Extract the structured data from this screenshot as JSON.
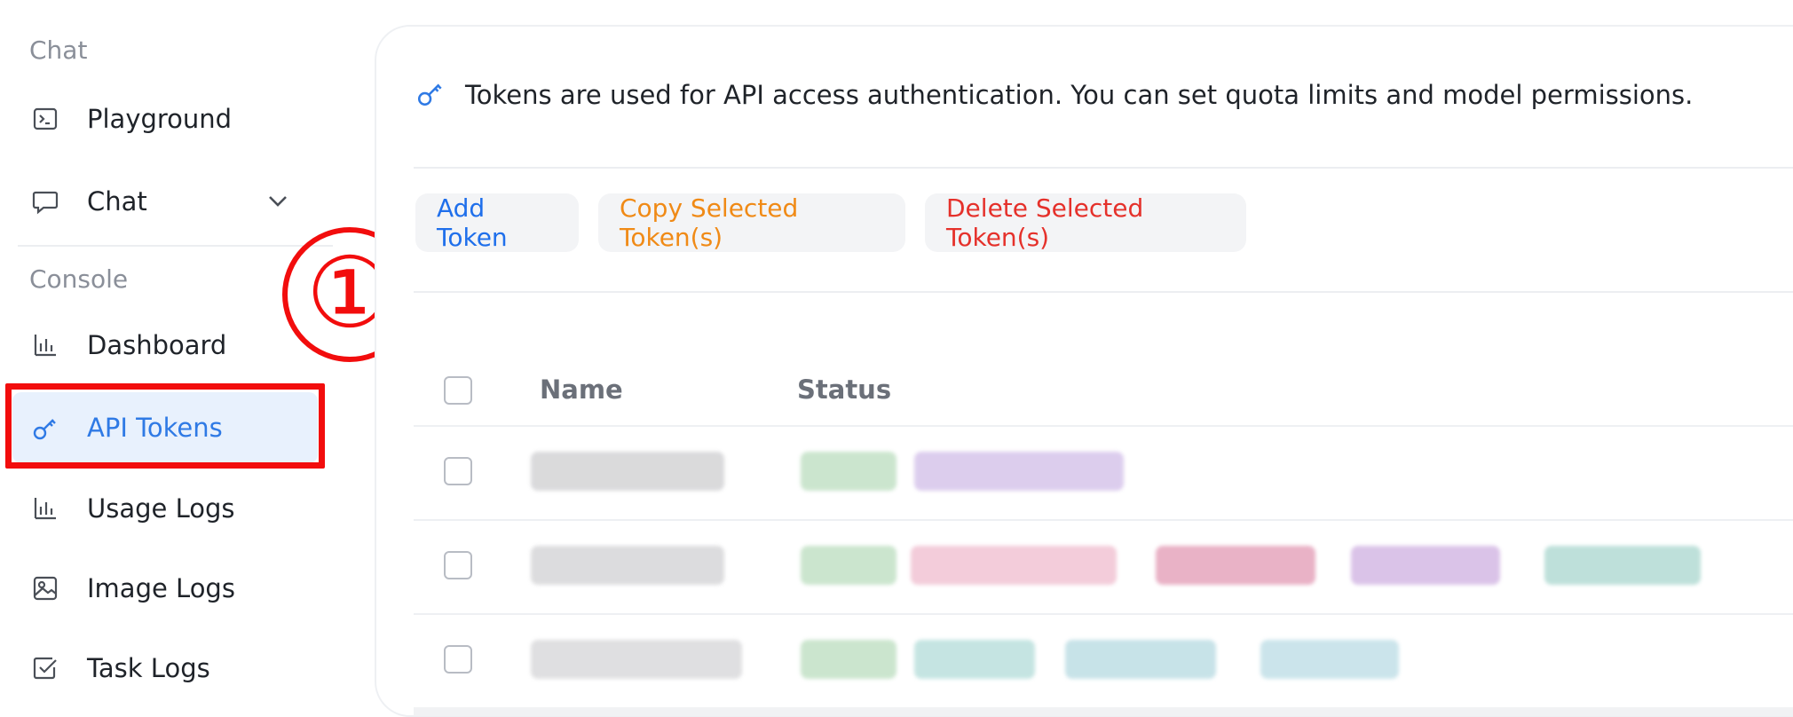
{
  "sidebar": {
    "section_chat": "Chat",
    "section_console": "Console",
    "items": [
      {
        "label": "Playground",
        "icon": "terminal-icon"
      },
      {
        "label": "Chat",
        "icon": "chat-bubble-icon"
      },
      {
        "label": "Dashboard",
        "icon": "bar-chart-icon"
      },
      {
        "label": "API Tokens",
        "icon": "key-icon",
        "active": true
      },
      {
        "label": "Usage Logs",
        "icon": "bar-chart-icon"
      },
      {
        "label": "Image Logs",
        "icon": "image-icon"
      },
      {
        "label": "Task Logs",
        "icon": "checkbox-icon"
      }
    ]
  },
  "annotation": {
    "marker": "①",
    "color": "#f20d0d"
  },
  "main": {
    "info": "Tokens are used for API access authentication. You can set quota limits and model permissions.",
    "buttons": {
      "add": "Add Token",
      "copy": "Copy Selected Token(s)",
      "delete": "Delete Selected Token(s)"
    },
    "table": {
      "headers": {
        "name": "Name",
        "status": "Status"
      }
    }
  },
  "colors": {
    "accent": "#2f7ae5",
    "active_bg": "#e8f1fd",
    "add": "#1f6feb",
    "copy": "#f08a16",
    "delete": "#e5312b"
  }
}
